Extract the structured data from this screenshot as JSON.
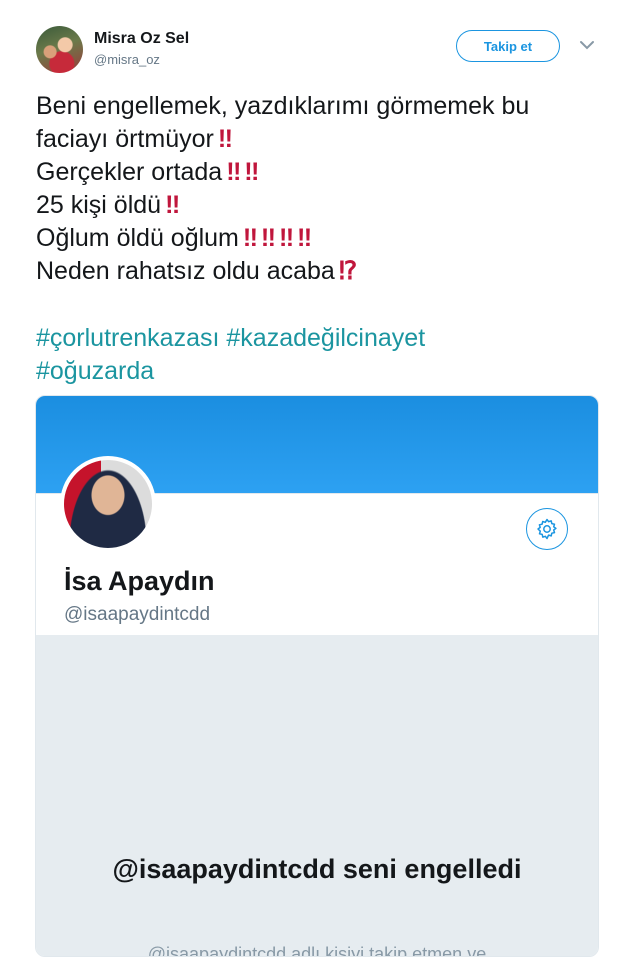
{
  "author": {
    "name": "Misra Oz Sel",
    "handle": "@misra_oz"
  },
  "follow_button": {
    "label": "Takip et"
  },
  "tweet": {
    "lines": [
      {
        "text": "Beni engellemek, yazdıklarımı görmemek bu",
        "emoji": ""
      },
      {
        "text": "faciayı örtmüyor",
        "emoji": "‼"
      },
      {
        "text": "Gerçekler ortada",
        "emoji": "‼ ‼"
      },
      {
        "text": "25 kişi öldü",
        "emoji": "‼"
      },
      {
        "text": "Oğlum öldü oğlum",
        "emoji": "‼ ‼ ‼ ‼"
      },
      {
        "text": "Neden rahatsız oldu acaba",
        "emoji": "⁉"
      }
    ],
    "hashtags": [
      "#çorlutrenkazası",
      "#kazadeğilcinayet",
      "#oğuzarda"
    ]
  },
  "embedded_screenshot": {
    "profile_name": "İsa Apaydın",
    "profile_handle": "@isaapaydintcdd",
    "blocked_title": "@isaapaydintcdd seni engelledi",
    "blocked_subtitle": "@isaapaydintcdd adlı kişiyi takip etmen ve"
  },
  "colors": {
    "brand": "#1b95e0",
    "hashtag": "#1b95a0",
    "emoji_red": "#c0163c",
    "banner": "#1b8ee0",
    "blocked_bg": "#e6ecf0"
  },
  "icons": [
    "avatar",
    "chevron-down-icon",
    "gear-icon",
    "profile-photo"
  ]
}
